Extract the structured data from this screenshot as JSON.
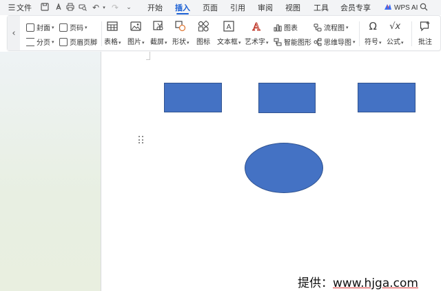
{
  "menubar": {
    "menu_icon": "hamburger-icon",
    "file_label": "文件",
    "quick_icons": [
      "save-icon",
      "pdf-export-icon",
      "print-icon",
      "print-preview-icon",
      "undo-icon",
      "redo-icon",
      "more-icon"
    ],
    "tabs": [
      {
        "label": "开始",
        "active": false
      },
      {
        "label": "插入",
        "active": true
      },
      {
        "label": "页面",
        "active": false
      },
      {
        "label": "引用",
        "active": false
      },
      {
        "label": "审阅",
        "active": false
      },
      {
        "label": "视图",
        "active": false
      },
      {
        "label": "工具",
        "active": false
      },
      {
        "label": "会员专享",
        "active": false
      }
    ],
    "wps_ai_label": "WPS AI",
    "search_icon": "search-icon"
  },
  "ribbon": {
    "cover_label": "封面",
    "page_break_label": "分页",
    "page_number_label": "页码",
    "header_footer_label": "页眉页脚",
    "table_label": "表格",
    "picture_label": "图片",
    "screenshot_label": "截屏",
    "shape_label": "形状",
    "icon_label": "图标",
    "textbox_label": "文本框",
    "wordart_label": "艺术字",
    "chart_label": "图表",
    "smart_graphic_label": "智能图形",
    "flowchart_label": "流程图",
    "mindmap_label": "思维导图",
    "symbol_label": "符号",
    "formula_label": "公式",
    "comment_label": "批注"
  },
  "document": {
    "shape_color": "#4472c4",
    "shape_border": "#2f528f"
  },
  "watermark": {
    "prefix": "提供：",
    "url": "www.hjga.com"
  }
}
